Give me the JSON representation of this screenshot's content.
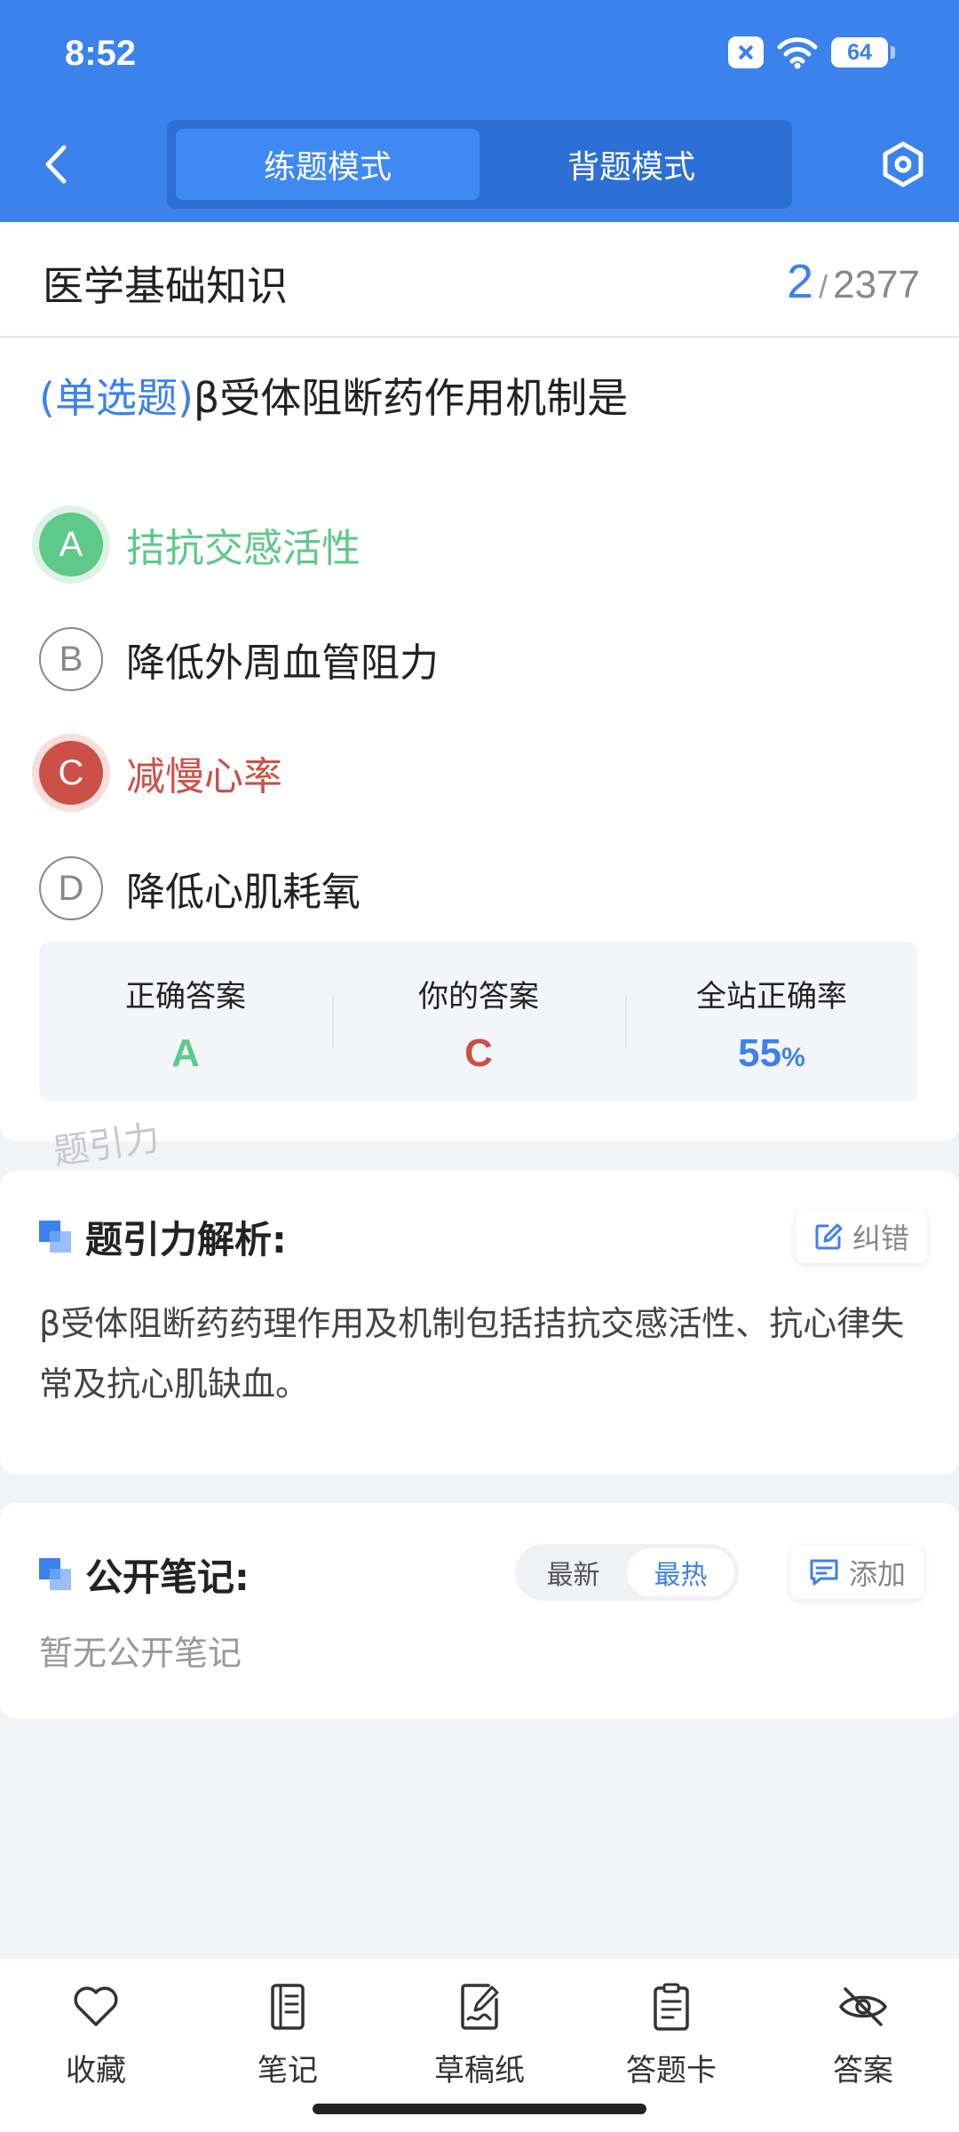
{
  "status_bar": {
    "time": "8:52",
    "battery": "64"
  },
  "header": {
    "modes": [
      {
        "label": "练题模式",
        "active": true
      },
      {
        "label": "背题模式",
        "active": false
      }
    ]
  },
  "subject": {
    "title": "医学基础知识",
    "current": "2",
    "separator": "/",
    "total": "2377"
  },
  "question": {
    "type": "(单选题)",
    "text": "β受体阻断药作用机制是",
    "options": [
      {
        "letter": "A",
        "text": "拮抗交感活性",
        "state": "correct"
      },
      {
        "letter": "B",
        "text": "降低外周血管阻力",
        "state": "normal"
      },
      {
        "letter": "C",
        "text": "减慢心率",
        "state": "wrong"
      },
      {
        "letter": "D",
        "text": "降低心肌耗氧",
        "state": "normal"
      }
    ]
  },
  "stats": {
    "correct_label": "正确答案",
    "correct_value": "A",
    "your_label": "你的答案",
    "your_value": "C",
    "rate_label": "全站正确率",
    "rate_value": "55",
    "rate_unit": "%"
  },
  "watermark": "题引力",
  "analysis": {
    "title": "题引力解析:",
    "correct_button": "纠错",
    "text": "β受体阻断药药理作用及机制包括拮抗交感活性、抗心律失常及抗心肌缺血。"
  },
  "notes": {
    "title": "公开笔记:",
    "sort_newest": "最新",
    "sort_hottest": "最热",
    "add_button": "添加",
    "empty": "暂无公开笔记"
  },
  "bottom_nav": [
    {
      "label": "收藏",
      "icon": "heart-icon"
    },
    {
      "label": "笔记",
      "icon": "notebook-icon"
    },
    {
      "label": "草稿纸",
      "icon": "draft-icon"
    },
    {
      "label": "答题卡",
      "icon": "answer-card-icon"
    },
    {
      "label": "答案",
      "icon": "eye-off-icon"
    }
  ],
  "colors": {
    "primary": "#3b82ec",
    "correct": "#5ec98a",
    "wrong": "#cc5047"
  }
}
